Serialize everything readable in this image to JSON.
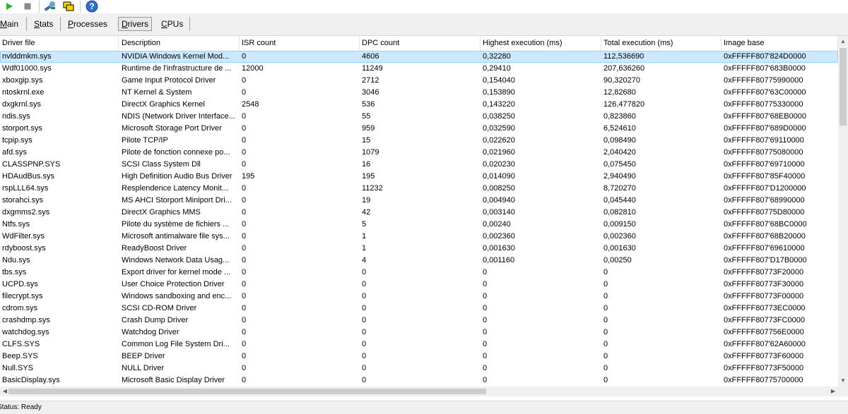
{
  "toolbar": {
    "buttons": [
      {
        "name": "start-icon",
        "color": "#2db52d"
      },
      {
        "name": "stop-icon",
        "color": "#8a8a8a"
      },
      {
        "name": "tools-icon",
        "color": "#3a6fb0"
      },
      {
        "name": "windows-icon",
        "color": "#e0c000"
      },
      {
        "name": "help-icon",
        "color": "#2f6fc8"
      }
    ]
  },
  "tabs": [
    {
      "label": "Main",
      "mnemonic_index": 0
    },
    {
      "label": "Stats",
      "mnemonic_index": 0
    },
    {
      "label": "Processes",
      "mnemonic_index": 0
    },
    {
      "label": "Drivers",
      "mnemonic_index": 0
    },
    {
      "label": "CPUs",
      "mnemonic_index": 0
    }
  ],
  "active_tab": "Drivers",
  "table": {
    "columns": [
      "Driver file",
      "Description",
      "ISR count",
      "DPC count",
      "Highest execution (ms)",
      "Total execution (ms)",
      "Image base"
    ],
    "selected_row": 0,
    "rows": [
      [
        "nvlddmkm.sys",
        "NVIDIA Windows Kernel Mod...",
        "0",
        "4606",
        "0,32280",
        "112,536690",
        "0xFFFFF807'824D0000"
      ],
      [
        "Wdf01000.sys",
        "Runtime de l'infrastructure de ...",
        "12000",
        "11249",
        "0,29410",
        "207,636260",
        "0xFFFFF807'683B0000"
      ],
      [
        "xboxgip.sys",
        "Game Input Protocol Driver",
        "0",
        "2712",
        "0,154040",
        "90,320270",
        "0xFFFFF80775990000"
      ],
      [
        "ntoskrnl.exe",
        "NT Kernel & System",
        "0",
        "3046",
        "0,153890",
        "12,82680",
        "0xFFFFF807'63C00000"
      ],
      [
        "dxgkrnl.sys",
        "DirectX Graphics Kernel",
        "2548",
        "536",
        "0,143220",
        "126,477820",
        "0xFFFFF80775330000"
      ],
      [
        "ndis.sys",
        "NDIS (Network Driver Interface...",
        "0",
        "55",
        "0,038250",
        "0,823860",
        "0xFFFFF807'68EB0000"
      ],
      [
        "storport.sys",
        "Microsoft Storage Port Driver",
        "0",
        "959",
        "0,032590",
        "6,524610",
        "0xFFFFF807'689D0000"
      ],
      [
        "tcpip.sys",
        "Pilote TCP/IP",
        "0",
        "15",
        "0,022620",
        "0,098490",
        "0xFFFFF807'69110000"
      ],
      [
        "afd.sys",
        "Pilote de fonction connexe po...",
        "0",
        "1079",
        "0,021960",
        "2,040420",
        "0xFFFFF80775080000"
      ],
      [
        "CLASSPNP.SYS",
        "SCSI Class System Dll",
        "0",
        "16",
        "0,020230",
        "0,075450",
        "0xFFFFF807'69710000"
      ],
      [
        "HDAudBus.sys",
        "High Definition Audio Bus Driver",
        "195",
        "195",
        "0,014090",
        "2,940490",
        "0xFFFFF807'85F40000"
      ],
      [
        "rspLLL64.sys",
        "Resplendence Latency Monit...",
        "0",
        "11232",
        "0,008250",
        "8,720270",
        "0xFFFFF807'D1200000"
      ],
      [
        "storahci.sys",
        "MS AHCI Storport Miniport Dri...",
        "0",
        "19",
        "0,004940",
        "0,045440",
        "0xFFFFF807'68990000"
      ],
      [
        "dxgmms2.sys",
        "DirectX Graphics MMS",
        "0",
        "42",
        "0,003140",
        "0,082810",
        "0xFFFFF80775D80000"
      ],
      [
        "Ntfs.sys",
        "Pilote du système de fichiers ...",
        "0",
        "5",
        "0,00240",
        "0,009150",
        "0xFFFFF807'68BC0000"
      ],
      [
        "WdFilter.sys",
        "Microsoft antimalware file sys...",
        "0",
        "1",
        "0,002360",
        "0,002360",
        "0xFFFFF807'68B20000"
      ],
      [
        "rdyboost.sys",
        "ReadyBoost Driver",
        "0",
        "1",
        "0,001630",
        "0,001630",
        "0xFFFFF807'69610000"
      ],
      [
        "Ndu.sys",
        "Windows Network Data Usag...",
        "0",
        "4",
        "0,001160",
        "0,00250",
        "0xFFFFF807'D17B0000"
      ],
      [
        "tbs.sys",
        "Export driver for kernel mode ...",
        "0",
        "0",
        "0",
        "0",
        "0xFFFFF80773F20000"
      ],
      [
        "UCPD.sys",
        "User Choice Protection Driver",
        "0",
        "0",
        "0",
        "0",
        "0xFFFFF80773F30000"
      ],
      [
        "filecrypt.sys",
        "Windows sandboxing and enc...",
        "0",
        "0",
        "0",
        "0",
        "0xFFFFF80773F00000"
      ],
      [
        "cdrom.sys",
        "SCSI CD-ROM Driver",
        "0",
        "0",
        "0",
        "0",
        "0xFFFFF80773EC0000"
      ],
      [
        "crashdmp.sys",
        "Crash Dump Driver",
        "0",
        "0",
        "0",
        "0",
        "0xFFFFF80773FC0000"
      ],
      [
        "watchdog.sys",
        "Watchdog Driver",
        "0",
        "0",
        "0",
        "0",
        "0xFFFFF807756E0000"
      ],
      [
        "CLFS.SYS",
        "Common Log File System Dri...",
        "0",
        "0",
        "0",
        "0",
        "0xFFFFF807'62A60000"
      ],
      [
        "Beep.SYS",
        "BEEP Driver",
        "0",
        "0",
        "0",
        "0",
        "0xFFFFF80773F60000"
      ],
      [
        "Null.SYS",
        "NULL Driver",
        "0",
        "0",
        "0",
        "0",
        "0xFFFFF80773F50000"
      ],
      [
        "BasicDisplay.sys",
        "Microsoft Basic Display Driver",
        "0",
        "0",
        "0",
        "0",
        "0xFFFFF80775700000"
      ]
    ]
  },
  "status": {
    "text": "Status: Ready"
  },
  "colors": {
    "selection": "#cce8ff",
    "selection_border": "#99d1ff"
  }
}
